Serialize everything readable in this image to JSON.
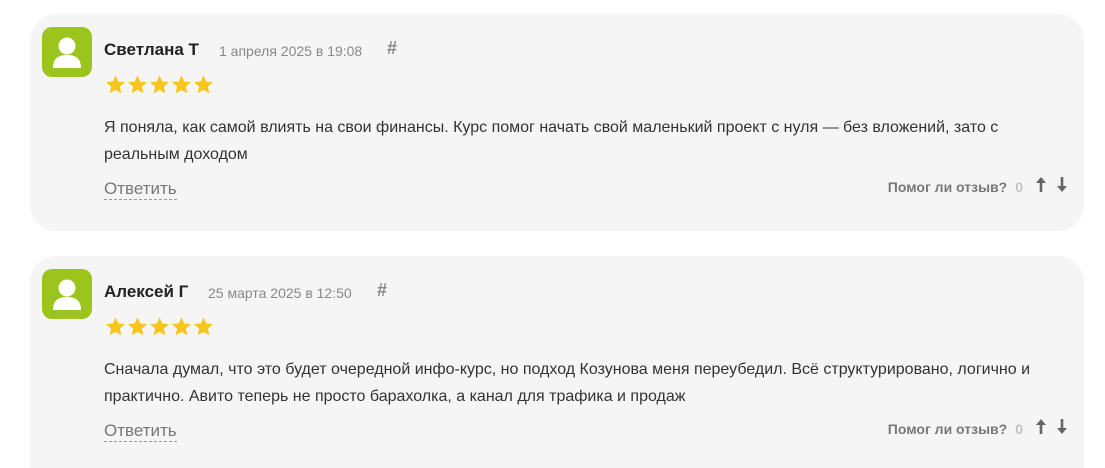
{
  "reviews": [
    {
      "author": "Светлана Т",
      "date": "1 апреля 2025 в 19:08",
      "anchor": "#",
      "rating": 5,
      "text": "Я поняла, как самой влиять на свои финансы. Курс помог начать свой маленький проект с нуля — без вложений, зато с реальным доходом",
      "reply_label": "Ответить",
      "helpful_label": "Помог ли отзыв?",
      "helpful_count": "0"
    },
    {
      "author": "Алексей Г",
      "date": "25 марта 2025 в 12:50",
      "anchor": "#",
      "rating": 5,
      "text": "Сначала думал, что это будет очередной инфо-курс, но подход Козунова меня переубедил. Всё структурировано, логично и практично. Авито теперь не просто барахолка, а канал для трафика и продаж",
      "reply_label": "Ответить",
      "helpful_label": "Помог ли отзыв?",
      "helpful_count": "0"
    }
  ],
  "colors": {
    "card_bg": "#f5f5f5",
    "avatar_bg": "#9bc41c",
    "star": "#f8c51c",
    "muted_text": "#888888"
  },
  "icons": {
    "avatar": "user-silhouette-icon",
    "star": "star-icon",
    "upvote": "arrow-up-icon",
    "downvote": "arrow-down-icon",
    "permalink": "hash-icon"
  }
}
